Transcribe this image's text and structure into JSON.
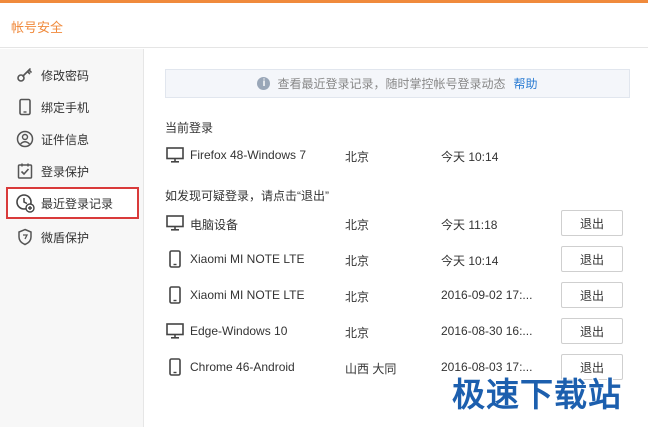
{
  "header": {
    "title": "帐号安全"
  },
  "sidebar": {
    "items": [
      {
        "label": "修改密码",
        "icon": "key-icon"
      },
      {
        "label": "绑定手机",
        "icon": "phone-icon"
      },
      {
        "label": "证件信息",
        "icon": "id-card-icon"
      },
      {
        "label": "登录保护",
        "icon": "login-protect-icon"
      },
      {
        "label": "最近登录记录",
        "icon": "recent-login-icon",
        "active": true
      },
      {
        "label": "微盾保护",
        "icon": "shield-icon"
      }
    ]
  },
  "notice": {
    "text": "查看最近登录记录，随时掌控帐号登录动态",
    "link": "帮助"
  },
  "current": {
    "title": "当前登录",
    "row": {
      "device": "Firefox 48-Windows 7",
      "type": "pc",
      "location": "北京",
      "time": "今天 10:14"
    }
  },
  "suspicious": {
    "title": "如发现可疑登录，请点击“退出”",
    "logout_label": "退出",
    "rows": [
      {
        "device": "电脑设备",
        "type": "pc",
        "location": "北京",
        "time": "今天 11:18"
      },
      {
        "device": "Xiaomi MI NOTE LTE",
        "type": "mobile",
        "location": "北京",
        "time": "今天 10:14"
      },
      {
        "device": "Xiaomi MI NOTE LTE",
        "type": "mobile",
        "location": "北京",
        "time": "2016-09-02 17:..."
      },
      {
        "device": "Edge-Windows 10",
        "type": "pc",
        "location": "北京",
        "time": "2016-08-30 16:..."
      },
      {
        "device": "Chrome 46-Android",
        "type": "mobile",
        "location": "山西 大同",
        "time": "2016-08-03 17:..."
      }
    ]
  },
  "watermark": {
    "text": "极速下载站"
  },
  "colors": {
    "accent": "#f08a3c",
    "active_border": "#d93a3a",
    "link": "#2b7cd3"
  }
}
